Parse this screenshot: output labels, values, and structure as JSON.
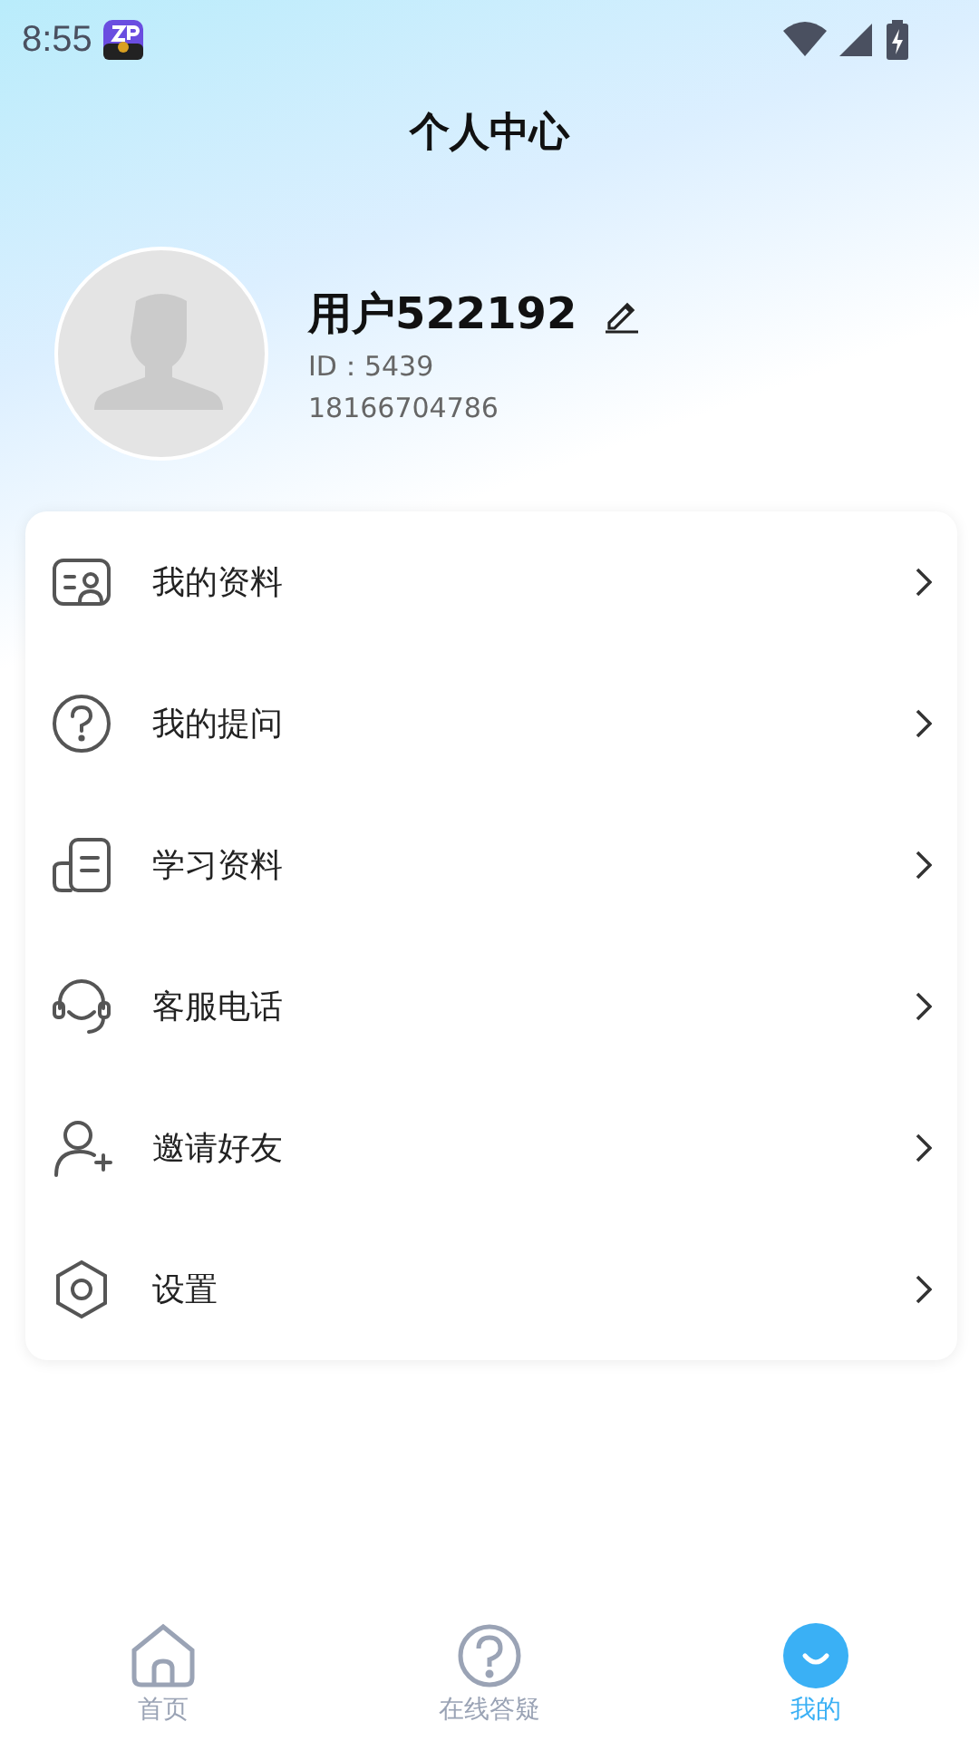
{
  "status_bar": {
    "time": "8:55"
  },
  "header": {
    "title": "个人中心"
  },
  "profile": {
    "name": "用户522192",
    "id": "ID：5439",
    "phone": "18166704786"
  },
  "menu": [
    {
      "kind": "profile-card",
      "label": "我的资料"
    },
    {
      "kind": "question",
      "label": "我的提问"
    },
    {
      "kind": "document",
      "label": "学习资料"
    },
    {
      "kind": "headset",
      "label": "客服电话"
    },
    {
      "kind": "invite",
      "label": "邀请好友"
    },
    {
      "kind": "settings",
      "label": "设置"
    }
  ],
  "tabs": [
    {
      "kind": "home",
      "label": "首页",
      "selected": false
    },
    {
      "kind": "question",
      "label": "在线答疑",
      "selected": false
    },
    {
      "kind": "mine",
      "label": "我的",
      "selected": true
    }
  ]
}
